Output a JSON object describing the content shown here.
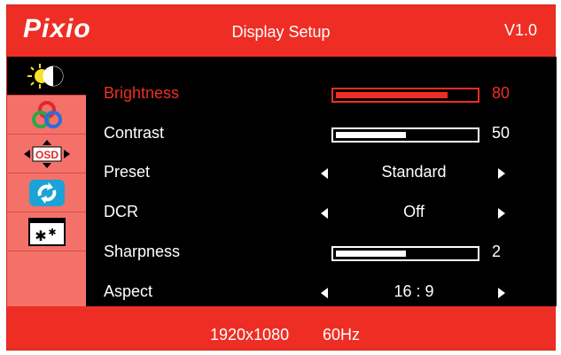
{
  "header": {
    "brand": "Pixio",
    "title": "Display Setup",
    "version": "V1.0"
  },
  "sidebar": {
    "tabs": [
      {
        "icon": "brightness-contrast-icon",
        "active": true
      },
      {
        "icon": "color-icon",
        "active": false
      },
      {
        "icon": "osd-settings-icon",
        "osd_label": "OSD",
        "active": false
      },
      {
        "icon": "reset-icon",
        "active": false
      },
      {
        "icon": "other-settings-icon",
        "active": false
      }
    ]
  },
  "menu": {
    "brightness": {
      "label": "Brightness",
      "value": "80",
      "level": 80,
      "max": 100,
      "active": true
    },
    "contrast": {
      "label": "Contrast",
      "value": "50",
      "level": 50,
      "max": 100
    },
    "preset": {
      "label": "Preset",
      "option": "Standard"
    },
    "dcr": {
      "label": "DCR",
      "option": "Off"
    },
    "sharpness": {
      "label": "Sharpness",
      "value": "2",
      "level": 2,
      "max": 4
    },
    "aspect": {
      "label": "Aspect",
      "option": "16 : 9"
    }
  },
  "footer": {
    "resolution": "1920x1080",
    "refresh_rate": "60Hz"
  },
  "colors": {
    "osd_red": "#ee2e24",
    "sidebar_pink": "#f4716a",
    "panel_black": "#000000",
    "text_white": "#ffffff"
  }
}
